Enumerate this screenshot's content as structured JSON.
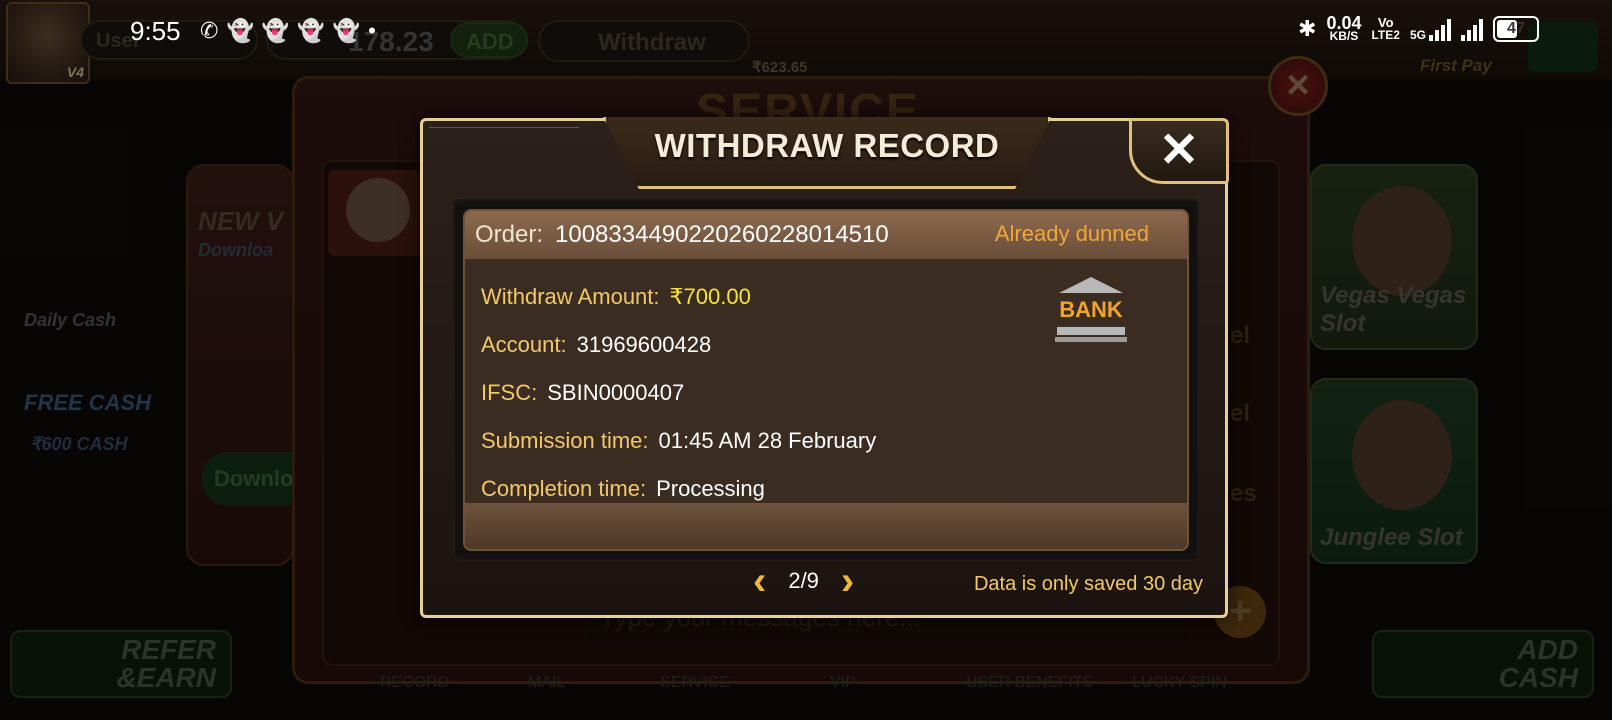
{
  "status_bar": {
    "time": "9:55",
    "net_speed": "0.04",
    "net_speed_unit": "KB/S",
    "volte_top": "Vo",
    "volte_bottom": "LTE2",
    "signal_5g": "5G",
    "battery": "47"
  },
  "background": {
    "user_label": "User",
    "balance": "178.23",
    "add_label": "ADD",
    "withdraw_label": "Withdraw",
    "bonus_amount": "₹623.65",
    "first_pay_label": "First Pay",
    "avatar_level": "V4",
    "service_title": "SERVICE",
    "daily_cash_label": "Daily Cash",
    "free_cash_label": "FREE CASH",
    "free_cash_amount": "₹600 CASH",
    "new_version_label": "NEW V",
    "download_sub_label": "Downloa",
    "download_button": "Downlo",
    "message_placeholder": "Type your messages here...",
    "right_card_top": "Vegas Vegas Slot",
    "right_card_bottom": "Junglee Slot",
    "refer_earn_line1": "REFER",
    "refer_earn_line2": "&EARN",
    "add_cash_line1": "ADD",
    "add_cash_line2": "CASH",
    "nav_items": [
      "RECORD",
      "MAIL",
      "SERVICE",
      "VIP",
      "USER BENEFITS",
      "LUCKY SPIN"
    ]
  },
  "dialog": {
    "title": "WITHDRAW RECORD",
    "close_label": "✕",
    "order_label": "Order:",
    "order_value": "1008334490220260228014510",
    "order_status": "Already dunned",
    "fields": [
      {
        "label": "Withdraw Amount:",
        "value": "₹700.00"
      },
      {
        "label": "Account:",
        "value": "31969600428"
      },
      {
        "label": "IFSC:",
        "value": "SBIN0000407"
      },
      {
        "label": "Submission time:",
        "value": "01:45 AM 28 February"
      },
      {
        "label": "Completion time:",
        "value": "Processing"
      }
    ],
    "bank_label": "BANK",
    "page_indicator": "2/9",
    "prev_arrow": "‹",
    "next_arrow": "›",
    "note": "Data is only saved 30 day"
  },
  "colors": {
    "dialog_border": "#e6cf9a",
    "status_text": "#f2a53a",
    "label_text": "#f2c86a",
    "amount_text": "#f7e23a"
  }
}
